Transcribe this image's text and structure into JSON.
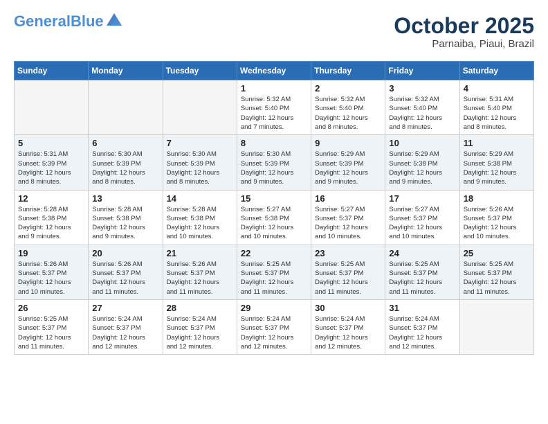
{
  "header": {
    "logo_line1": "General",
    "logo_line2": "Blue",
    "month": "October 2025",
    "location": "Parnaiba, Piaui, Brazil"
  },
  "weekdays": [
    "Sunday",
    "Monday",
    "Tuesday",
    "Wednesday",
    "Thursday",
    "Friday",
    "Saturday"
  ],
  "weeks": [
    [
      {
        "day": "",
        "info": ""
      },
      {
        "day": "",
        "info": ""
      },
      {
        "day": "",
        "info": ""
      },
      {
        "day": "1",
        "info": "Sunrise: 5:32 AM\nSunset: 5:40 PM\nDaylight: 12 hours\nand 7 minutes."
      },
      {
        "day": "2",
        "info": "Sunrise: 5:32 AM\nSunset: 5:40 PM\nDaylight: 12 hours\nand 8 minutes."
      },
      {
        "day": "3",
        "info": "Sunrise: 5:32 AM\nSunset: 5:40 PM\nDaylight: 12 hours\nand 8 minutes."
      },
      {
        "day": "4",
        "info": "Sunrise: 5:31 AM\nSunset: 5:40 PM\nDaylight: 12 hours\nand 8 minutes."
      }
    ],
    [
      {
        "day": "5",
        "info": "Sunrise: 5:31 AM\nSunset: 5:39 PM\nDaylight: 12 hours\nand 8 minutes."
      },
      {
        "day": "6",
        "info": "Sunrise: 5:30 AM\nSunset: 5:39 PM\nDaylight: 12 hours\nand 8 minutes."
      },
      {
        "day": "7",
        "info": "Sunrise: 5:30 AM\nSunset: 5:39 PM\nDaylight: 12 hours\nand 8 minutes."
      },
      {
        "day": "8",
        "info": "Sunrise: 5:30 AM\nSunset: 5:39 PM\nDaylight: 12 hours\nand 9 minutes."
      },
      {
        "day": "9",
        "info": "Sunrise: 5:29 AM\nSunset: 5:39 PM\nDaylight: 12 hours\nand 9 minutes."
      },
      {
        "day": "10",
        "info": "Sunrise: 5:29 AM\nSunset: 5:38 PM\nDaylight: 12 hours\nand 9 minutes."
      },
      {
        "day": "11",
        "info": "Sunrise: 5:29 AM\nSunset: 5:38 PM\nDaylight: 12 hours\nand 9 minutes."
      }
    ],
    [
      {
        "day": "12",
        "info": "Sunrise: 5:28 AM\nSunset: 5:38 PM\nDaylight: 12 hours\nand 9 minutes."
      },
      {
        "day": "13",
        "info": "Sunrise: 5:28 AM\nSunset: 5:38 PM\nDaylight: 12 hours\nand 9 minutes."
      },
      {
        "day": "14",
        "info": "Sunrise: 5:28 AM\nSunset: 5:38 PM\nDaylight: 12 hours\nand 10 minutes."
      },
      {
        "day": "15",
        "info": "Sunrise: 5:27 AM\nSunset: 5:38 PM\nDaylight: 12 hours\nand 10 minutes."
      },
      {
        "day": "16",
        "info": "Sunrise: 5:27 AM\nSunset: 5:37 PM\nDaylight: 12 hours\nand 10 minutes."
      },
      {
        "day": "17",
        "info": "Sunrise: 5:27 AM\nSunset: 5:37 PM\nDaylight: 12 hours\nand 10 minutes."
      },
      {
        "day": "18",
        "info": "Sunrise: 5:26 AM\nSunset: 5:37 PM\nDaylight: 12 hours\nand 10 minutes."
      }
    ],
    [
      {
        "day": "19",
        "info": "Sunrise: 5:26 AM\nSunset: 5:37 PM\nDaylight: 12 hours\nand 10 minutes."
      },
      {
        "day": "20",
        "info": "Sunrise: 5:26 AM\nSunset: 5:37 PM\nDaylight: 12 hours\nand 11 minutes."
      },
      {
        "day": "21",
        "info": "Sunrise: 5:26 AM\nSunset: 5:37 PM\nDaylight: 12 hours\nand 11 minutes."
      },
      {
        "day": "22",
        "info": "Sunrise: 5:25 AM\nSunset: 5:37 PM\nDaylight: 12 hours\nand 11 minutes."
      },
      {
        "day": "23",
        "info": "Sunrise: 5:25 AM\nSunset: 5:37 PM\nDaylight: 12 hours\nand 11 minutes."
      },
      {
        "day": "24",
        "info": "Sunrise: 5:25 AM\nSunset: 5:37 PM\nDaylight: 12 hours\nand 11 minutes."
      },
      {
        "day": "25",
        "info": "Sunrise: 5:25 AM\nSunset: 5:37 PM\nDaylight: 12 hours\nand 11 minutes."
      }
    ],
    [
      {
        "day": "26",
        "info": "Sunrise: 5:25 AM\nSunset: 5:37 PM\nDaylight: 12 hours\nand 11 minutes."
      },
      {
        "day": "27",
        "info": "Sunrise: 5:24 AM\nSunset: 5:37 PM\nDaylight: 12 hours\nand 12 minutes."
      },
      {
        "day": "28",
        "info": "Sunrise: 5:24 AM\nSunset: 5:37 PM\nDaylight: 12 hours\nand 12 minutes."
      },
      {
        "day": "29",
        "info": "Sunrise: 5:24 AM\nSunset: 5:37 PM\nDaylight: 12 hours\nand 12 minutes."
      },
      {
        "day": "30",
        "info": "Sunrise: 5:24 AM\nSunset: 5:37 PM\nDaylight: 12 hours\nand 12 minutes."
      },
      {
        "day": "31",
        "info": "Sunrise: 5:24 AM\nSunset: 5:37 PM\nDaylight: 12 hours\nand 12 minutes."
      },
      {
        "day": "",
        "info": ""
      }
    ]
  ]
}
